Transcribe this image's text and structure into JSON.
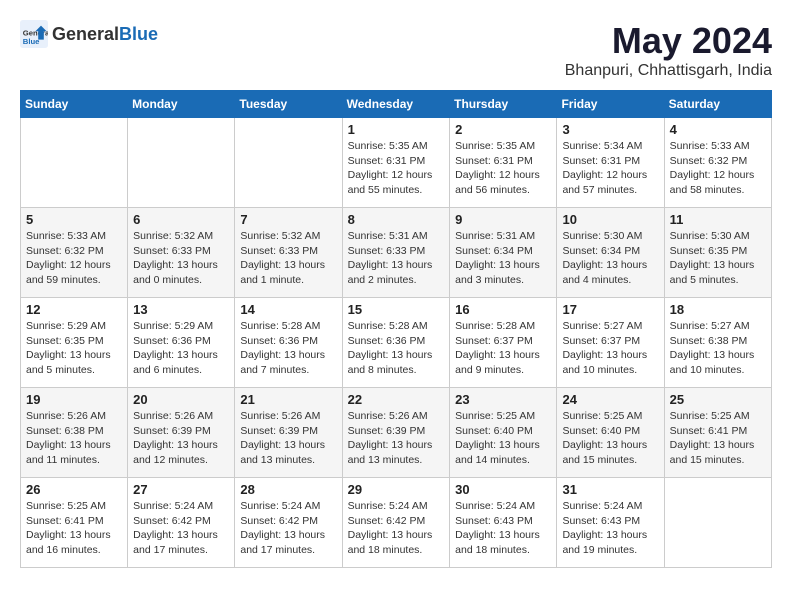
{
  "logo": {
    "text_general": "General",
    "text_blue": "Blue"
  },
  "title": {
    "month_year": "May 2024",
    "location": "Bhanpuri, Chhattisgarh, India"
  },
  "weekdays": [
    "Sunday",
    "Monday",
    "Tuesday",
    "Wednesday",
    "Thursday",
    "Friday",
    "Saturday"
  ],
  "weeks": [
    [
      {
        "day": "",
        "details": ""
      },
      {
        "day": "",
        "details": ""
      },
      {
        "day": "",
        "details": ""
      },
      {
        "day": "1",
        "details": "Sunrise: 5:35 AM\nSunset: 6:31 PM\nDaylight: 12 hours\nand 55 minutes."
      },
      {
        "day": "2",
        "details": "Sunrise: 5:35 AM\nSunset: 6:31 PM\nDaylight: 12 hours\nand 56 minutes."
      },
      {
        "day": "3",
        "details": "Sunrise: 5:34 AM\nSunset: 6:31 PM\nDaylight: 12 hours\nand 57 minutes."
      },
      {
        "day": "4",
        "details": "Sunrise: 5:33 AM\nSunset: 6:32 PM\nDaylight: 12 hours\nand 58 minutes."
      }
    ],
    [
      {
        "day": "5",
        "details": "Sunrise: 5:33 AM\nSunset: 6:32 PM\nDaylight: 12 hours\nand 59 minutes."
      },
      {
        "day": "6",
        "details": "Sunrise: 5:32 AM\nSunset: 6:33 PM\nDaylight: 13 hours\nand 0 minutes."
      },
      {
        "day": "7",
        "details": "Sunrise: 5:32 AM\nSunset: 6:33 PM\nDaylight: 13 hours\nand 1 minute."
      },
      {
        "day": "8",
        "details": "Sunrise: 5:31 AM\nSunset: 6:33 PM\nDaylight: 13 hours\nand 2 minutes."
      },
      {
        "day": "9",
        "details": "Sunrise: 5:31 AM\nSunset: 6:34 PM\nDaylight: 13 hours\nand 3 minutes."
      },
      {
        "day": "10",
        "details": "Sunrise: 5:30 AM\nSunset: 6:34 PM\nDaylight: 13 hours\nand 4 minutes."
      },
      {
        "day": "11",
        "details": "Sunrise: 5:30 AM\nSunset: 6:35 PM\nDaylight: 13 hours\nand 5 minutes."
      }
    ],
    [
      {
        "day": "12",
        "details": "Sunrise: 5:29 AM\nSunset: 6:35 PM\nDaylight: 13 hours\nand 5 minutes."
      },
      {
        "day": "13",
        "details": "Sunrise: 5:29 AM\nSunset: 6:36 PM\nDaylight: 13 hours\nand 6 minutes."
      },
      {
        "day": "14",
        "details": "Sunrise: 5:28 AM\nSunset: 6:36 PM\nDaylight: 13 hours\nand 7 minutes."
      },
      {
        "day": "15",
        "details": "Sunrise: 5:28 AM\nSunset: 6:36 PM\nDaylight: 13 hours\nand 8 minutes."
      },
      {
        "day": "16",
        "details": "Sunrise: 5:28 AM\nSunset: 6:37 PM\nDaylight: 13 hours\nand 9 minutes."
      },
      {
        "day": "17",
        "details": "Sunrise: 5:27 AM\nSunset: 6:37 PM\nDaylight: 13 hours\nand 10 minutes."
      },
      {
        "day": "18",
        "details": "Sunrise: 5:27 AM\nSunset: 6:38 PM\nDaylight: 13 hours\nand 10 minutes."
      }
    ],
    [
      {
        "day": "19",
        "details": "Sunrise: 5:26 AM\nSunset: 6:38 PM\nDaylight: 13 hours\nand 11 minutes."
      },
      {
        "day": "20",
        "details": "Sunrise: 5:26 AM\nSunset: 6:39 PM\nDaylight: 13 hours\nand 12 minutes."
      },
      {
        "day": "21",
        "details": "Sunrise: 5:26 AM\nSunset: 6:39 PM\nDaylight: 13 hours\nand 13 minutes."
      },
      {
        "day": "22",
        "details": "Sunrise: 5:26 AM\nSunset: 6:39 PM\nDaylight: 13 hours\nand 13 minutes."
      },
      {
        "day": "23",
        "details": "Sunrise: 5:25 AM\nSunset: 6:40 PM\nDaylight: 13 hours\nand 14 minutes."
      },
      {
        "day": "24",
        "details": "Sunrise: 5:25 AM\nSunset: 6:40 PM\nDaylight: 13 hours\nand 15 minutes."
      },
      {
        "day": "25",
        "details": "Sunrise: 5:25 AM\nSunset: 6:41 PM\nDaylight: 13 hours\nand 15 minutes."
      }
    ],
    [
      {
        "day": "26",
        "details": "Sunrise: 5:25 AM\nSunset: 6:41 PM\nDaylight: 13 hours\nand 16 minutes."
      },
      {
        "day": "27",
        "details": "Sunrise: 5:24 AM\nSunset: 6:42 PM\nDaylight: 13 hours\nand 17 minutes."
      },
      {
        "day": "28",
        "details": "Sunrise: 5:24 AM\nSunset: 6:42 PM\nDaylight: 13 hours\nand 17 minutes."
      },
      {
        "day": "29",
        "details": "Sunrise: 5:24 AM\nSunset: 6:42 PM\nDaylight: 13 hours\nand 18 minutes."
      },
      {
        "day": "30",
        "details": "Sunrise: 5:24 AM\nSunset: 6:43 PM\nDaylight: 13 hours\nand 18 minutes."
      },
      {
        "day": "31",
        "details": "Sunrise: 5:24 AM\nSunset: 6:43 PM\nDaylight: 13 hours\nand 19 minutes."
      },
      {
        "day": "",
        "details": ""
      }
    ]
  ]
}
